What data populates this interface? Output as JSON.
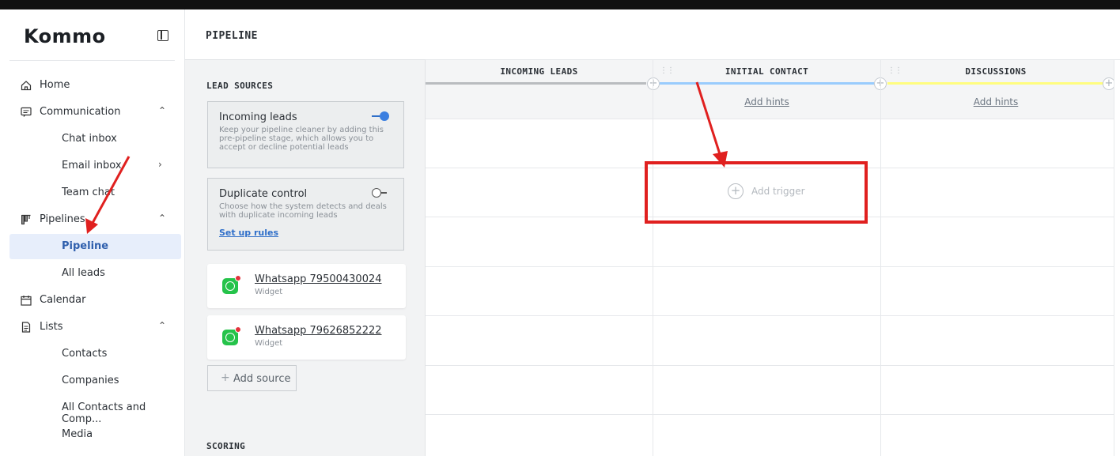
{
  "brand": {
    "logo_text": "Kommo"
  },
  "sidebar": {
    "items": [
      {
        "label": "Home",
        "icon": "home-icon"
      },
      {
        "label": "Communication",
        "icon": "chat-icon",
        "chevron": "^"
      },
      {
        "label": "Chat inbox"
      },
      {
        "label": "Email inbox",
        "chevron": ">"
      },
      {
        "label": "Team chat"
      },
      {
        "label": "Pipelines",
        "icon": "pipeline-icon",
        "chevron": "^"
      },
      {
        "label": "Pipeline",
        "active": true
      },
      {
        "label": "All leads"
      },
      {
        "label": "Calendar",
        "icon": "calendar-icon"
      },
      {
        "label": "Lists",
        "icon": "document-icon",
        "chevron": "^"
      },
      {
        "label": "Contacts"
      },
      {
        "label": "Companies"
      },
      {
        "label": "All Contacts and Comp..."
      },
      {
        "label": "Media"
      }
    ]
  },
  "panel": {
    "title": "PIPELINE",
    "lead_sources_title": "LEAD SOURCES",
    "incoming_card": {
      "title": "Incoming leads",
      "description": "Keep your pipeline cleaner by adding this pre-pipeline stage, which allows you to accept or decline potential leads",
      "toggle_on": true
    },
    "duplicate_card": {
      "title": "Duplicate control",
      "description": "Choose how the system detects and deals with duplicate incoming leads",
      "link": "Set up rules",
      "toggle_on": false
    },
    "sources": [
      {
        "name": "Whatsapp 79500430024",
        "type": "Widget"
      },
      {
        "name": "Whatsapp 79626852222",
        "type": "Widget"
      }
    ],
    "add_source": "Add source",
    "scoring_title": "SCORING"
  },
  "board": {
    "stages": [
      {
        "name": "INCOMING LEADS",
        "color": "#b9bcbf",
        "hint": ""
      },
      {
        "name": "INITIAL CONTACT",
        "color": "#99ccfd",
        "hint": "Add hints"
      },
      {
        "name": "DISCUSSIONS",
        "color": "#fffd7f",
        "hint": "Add hints"
      }
    ],
    "add_trigger": "Add trigger"
  },
  "colors": {
    "accent": "#2f6fc9",
    "annotation_red": "#e0201f",
    "active_bg": "#e7eefb"
  }
}
